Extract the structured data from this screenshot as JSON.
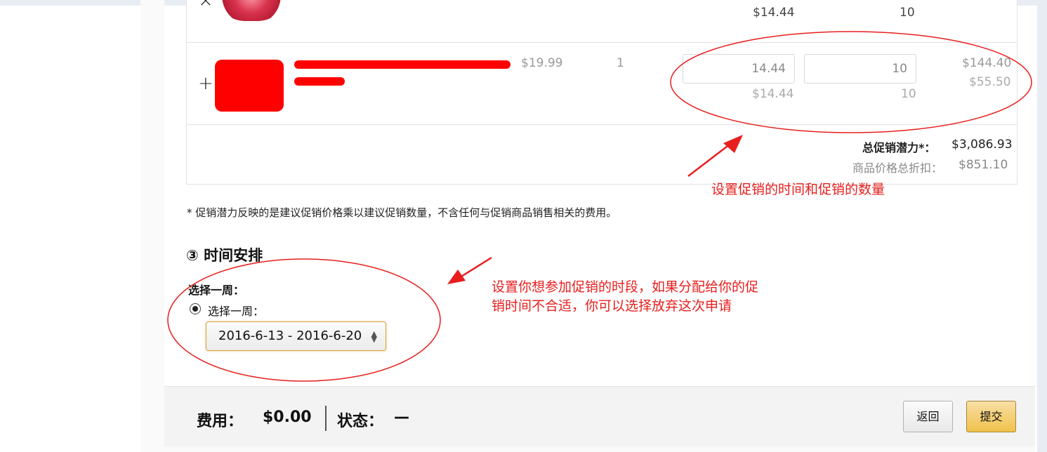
{
  "row1": {
    "price_col": "$14.44",
    "qty_col": "10",
    "expand_symbol": "×"
  },
  "row2": {
    "expand_symbol": "+",
    "list_price": "$19.99",
    "stock_qty": "1",
    "promo_price_input": "14.44",
    "promo_qty_input": "10",
    "promo_price_suggest": "$14.44",
    "promo_qty_suggest": "10",
    "potential_total": "$144.40",
    "discount_total": "$55.50"
  },
  "totals": {
    "potential_label": "总促销潜力*：",
    "potential_value": "$3,086.93",
    "discount_label": "商品价格总折扣：",
    "discount_value": "$851.10"
  },
  "footnote": "* 促销潜力反映的是建议促销价格乘以建议促销数量，不含任何与促销商品销售相关的费用。",
  "schedule": {
    "section_title": "③ 时间安排",
    "week_label": "选择一周：",
    "radio_label": "选择一周：",
    "selected_week": "2016-6-13 - 2016-6-20"
  },
  "footer": {
    "fee_label": "费用：",
    "fee_value": "$0.00",
    "status_label": "状态：",
    "status_value": "—",
    "back_button": "返回",
    "submit_button": "提交"
  },
  "annotations": {
    "note1": "设置促销的时间和促销的数量",
    "note2_line1": "设置你想参加促销的时段，如果分配给你的促",
    "note2_line2": "销时间不合适，你可以选择放弃这次申请",
    "color": "#e81e1e"
  },
  "colors": {
    "submit_bg": "#f0c14b",
    "select_border": "#d7a83a",
    "redaction": "#ff0000"
  }
}
